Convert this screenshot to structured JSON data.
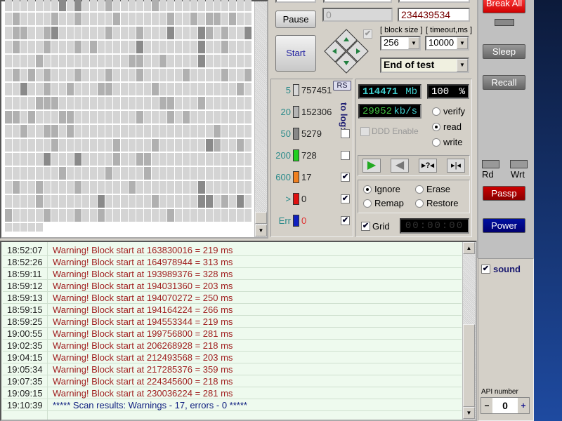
{
  "controls": {
    "pause_label": "Pause",
    "start_label": "Start",
    "start_lba": "0",
    "end_lba": "234439534",
    "block_size_label": "[ block size ]",
    "block_size": "256",
    "timeout_label": "[ timeout,ms ]",
    "timeout": "10000",
    "end_action": "End of test",
    "rs_label": "RS",
    "to_log_label": "to log:"
  },
  "legend": [
    {
      "threshold": "5",
      "count": "757451",
      "color": "#d8d8d8",
      "log": null
    },
    {
      "threshold": "20",
      "count": "152306",
      "color": "#b4b4b4",
      "log": null
    },
    {
      "threshold": "50",
      "count": "5279",
      "color": "#888888",
      "log": false
    },
    {
      "threshold": "200",
      "count": "728",
      "color": "#20d020",
      "log": false
    },
    {
      "threshold": "600",
      "count": "17",
      "color": "#f08020",
      "log": true
    },
    {
      "threshold": ">",
      "count": "0",
      "color": "#e01010",
      "log": true
    },
    {
      "threshold": "Err",
      "count": "0",
      "color": "#1020c0",
      "log": true
    }
  ],
  "stats": {
    "size_value": "114471",
    "size_unit": "Mb",
    "percent_value": "100",
    "percent_unit": "%",
    "speed_value": "29952",
    "speed_unit": "kb/s",
    "ddd_label": "DDD Enable",
    "timer": "00:00:00",
    "grid_label": "Grid"
  },
  "modes": [
    {
      "label": "verify",
      "on": false
    },
    {
      "label": "read",
      "on": true
    },
    {
      "label": "write",
      "on": false
    }
  ],
  "actions": [
    {
      "label": "Ignore",
      "on": true
    },
    {
      "label": "Erase",
      "on": false
    },
    {
      "label": "Remap",
      "on": false
    },
    {
      "label": "Restore",
      "on": false
    }
  ],
  "side": {
    "break_label": "Break All",
    "sleep_label": "Sleep",
    "recall_label": "Recall",
    "rd_label": "Rd",
    "wrt_label": "Wrt",
    "passp_label": "Passp",
    "power_label": "Power",
    "sound_label": "sound",
    "api_label": "API number",
    "api_value": "0",
    "minus": "−",
    "plus": "+"
  },
  "log": [
    {
      "time": "18:52:07",
      "msg": "Warning! Block start at 163830016 = 219 ms",
      "type": "warn"
    },
    {
      "time": "18:52:26",
      "msg": "Warning! Block start at 164978944 = 313 ms",
      "type": "warn"
    },
    {
      "time": "18:59:11",
      "msg": "Warning! Block start at 193989376 = 328 ms",
      "type": "warn"
    },
    {
      "time": "18:59:12",
      "msg": "Warning! Block start at 194031360 = 203 ms",
      "type": "warn"
    },
    {
      "time": "18:59:13",
      "msg": "Warning! Block start at 194070272 = 250 ms",
      "type": "warn"
    },
    {
      "time": "18:59:15",
      "msg": "Warning! Block start at 194164224 = 266 ms",
      "type": "warn"
    },
    {
      "time": "18:59:25",
      "msg": "Warning! Block start at 194553344 = 219 ms",
      "type": "warn"
    },
    {
      "time": "19:00:55",
      "msg": "Warning! Block start at 199756800 = 281 ms",
      "type": "warn"
    },
    {
      "time": "19:02:35",
      "msg": "Warning! Block start at 206268928 = 218 ms",
      "type": "warn"
    },
    {
      "time": "19:04:15",
      "msg": "Warning! Block start at 212493568 = 203 ms",
      "type": "warn"
    },
    {
      "time": "19:05:34",
      "msg": "Warning! Block start at 217285376 = 359 ms",
      "type": "warn"
    },
    {
      "time": "19:07:35",
      "msg": "Warning! Block start at 224345600 = 218 ms",
      "type": "warn"
    },
    {
      "time": "19:09:15",
      "msg": "Warning! Block start at 230036224 = 281 ms",
      "type": "warn"
    },
    {
      "time": "19:10:39",
      "msg": "***** Scan results: Warnings - 17, errors - 0 *****",
      "type": "info"
    }
  ],
  "colors": {
    "warn": "#a02020",
    "info": "#102080",
    "lcd_cyan": "#40d0d0",
    "lcd_green": "#40c040"
  }
}
